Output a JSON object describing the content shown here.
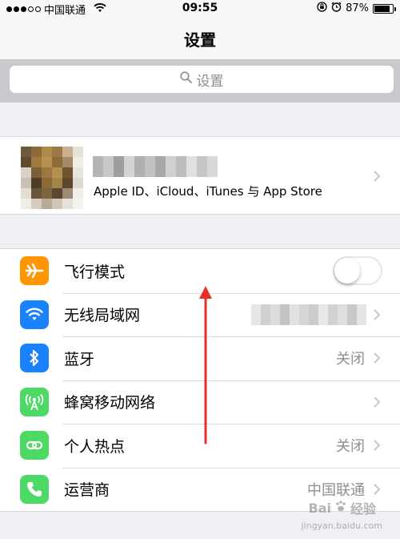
{
  "status_bar": {
    "carrier": "中国联通",
    "time": "09:55",
    "battery_percent": "87%",
    "battery_level": 0.87
  },
  "navbar": {
    "title": "设置"
  },
  "search": {
    "placeholder": "设置"
  },
  "profile": {
    "subtitle": "Apple ID、iCloud、iTunes 与 App Store"
  },
  "settings": {
    "airplane": {
      "label": "飞行模式",
      "toggle_on": false,
      "icon": "airplane-icon",
      "color": "#ff9500"
    },
    "wifi": {
      "label": "无线局域网",
      "icon": "wifi-icon",
      "color": "#1a82fb"
    },
    "bluetooth": {
      "label": "蓝牙",
      "value": "关闭",
      "icon": "bluetooth-icon",
      "color": "#1a82fb"
    },
    "cellular": {
      "label": "蜂窝移动网络",
      "icon": "cellular-icon",
      "color": "#4cd964"
    },
    "hotspot": {
      "label": "个人热点",
      "value": "关闭",
      "icon": "hotspot-icon",
      "color": "#4cd964"
    },
    "carrier": {
      "label": "运营商",
      "value": "中国联通",
      "icon": "phone-icon",
      "color": "#4cd964"
    }
  },
  "watermark": {
    "brand": "Bai",
    "suffix": "经验",
    "url": "jingyan.baidu.com"
  },
  "colors": {
    "annotation_arrow": "#e8302a",
    "group_background": "#efeff4"
  }
}
